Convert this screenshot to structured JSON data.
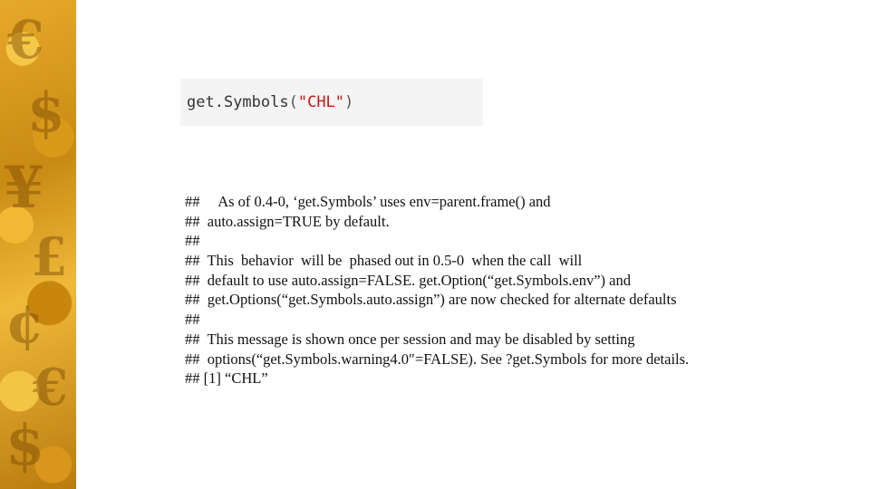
{
  "code": {
    "function": "get.Symbols",
    "open_paren": "(",
    "argument": "\"CHL\"",
    "close_paren": ")"
  },
  "output_lines": [
    "##     As of 0.4-0, ‘get.Symbols’ uses env=parent.frame() and",
    "##  auto.assign=TRUE by default.",
    "##",
    "##  This  behavior  will be  phased out in 0.5-0  when the call  will",
    "##  default to use auto.assign=FALSE. get.Option(“get.Symbols.env”) and",
    "##  get.Options(“get.Symbols.auto.assign”) are now checked for alternate defaults",
    "##",
    "##  This message is shown once per session and may be disabled by setting",
    "##  options(“get.Symbols.warning4.0″=FALSE). See ?get.Symbols for more details.",
    "## [1] “CHL”"
  ],
  "colors": {
    "band": "#d99a1a",
    "code_background": "#f4f4f4",
    "string": "#c41a16"
  },
  "icons": [
    "currency-symbols-decoration"
  ]
}
